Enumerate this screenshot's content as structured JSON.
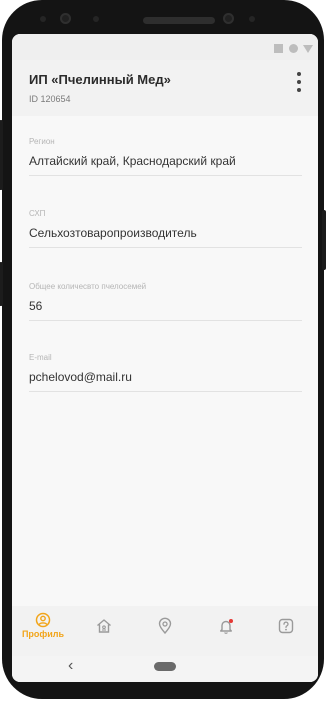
{
  "colors": {
    "accent": "#f2a51a",
    "badge": "#e53935",
    "icon_inactive": "#9a9a9a"
  },
  "header": {
    "title": "ИП «Пчелинный Мед»",
    "subtitle": "ID 120654",
    "menu_icon": "more-vert-icon"
  },
  "fields": [
    {
      "label": "Регион",
      "value": "Алтайский край, Краснодарский край"
    },
    {
      "label": "СХП",
      "value": "Сельхозтоваропроизводитель"
    },
    {
      "label": "Общее количесвто пчелосемей",
      "value": "56"
    },
    {
      "label": "E-mail",
      "value": "pchelovod@mail.ru"
    }
  ],
  "nav": {
    "items": [
      {
        "icon": "profile-icon",
        "label": "Профиль",
        "active": true
      },
      {
        "icon": "apiary-home-icon",
        "active": false
      },
      {
        "icon": "location-pin-icon",
        "active": false
      },
      {
        "icon": "notifications-bell-icon",
        "active": false,
        "badge": true
      },
      {
        "icon": "help-icon",
        "active": false
      }
    ]
  },
  "system_nav": {
    "back_icon": "chevron-left-icon",
    "home_icon": "home-pill-icon"
  }
}
